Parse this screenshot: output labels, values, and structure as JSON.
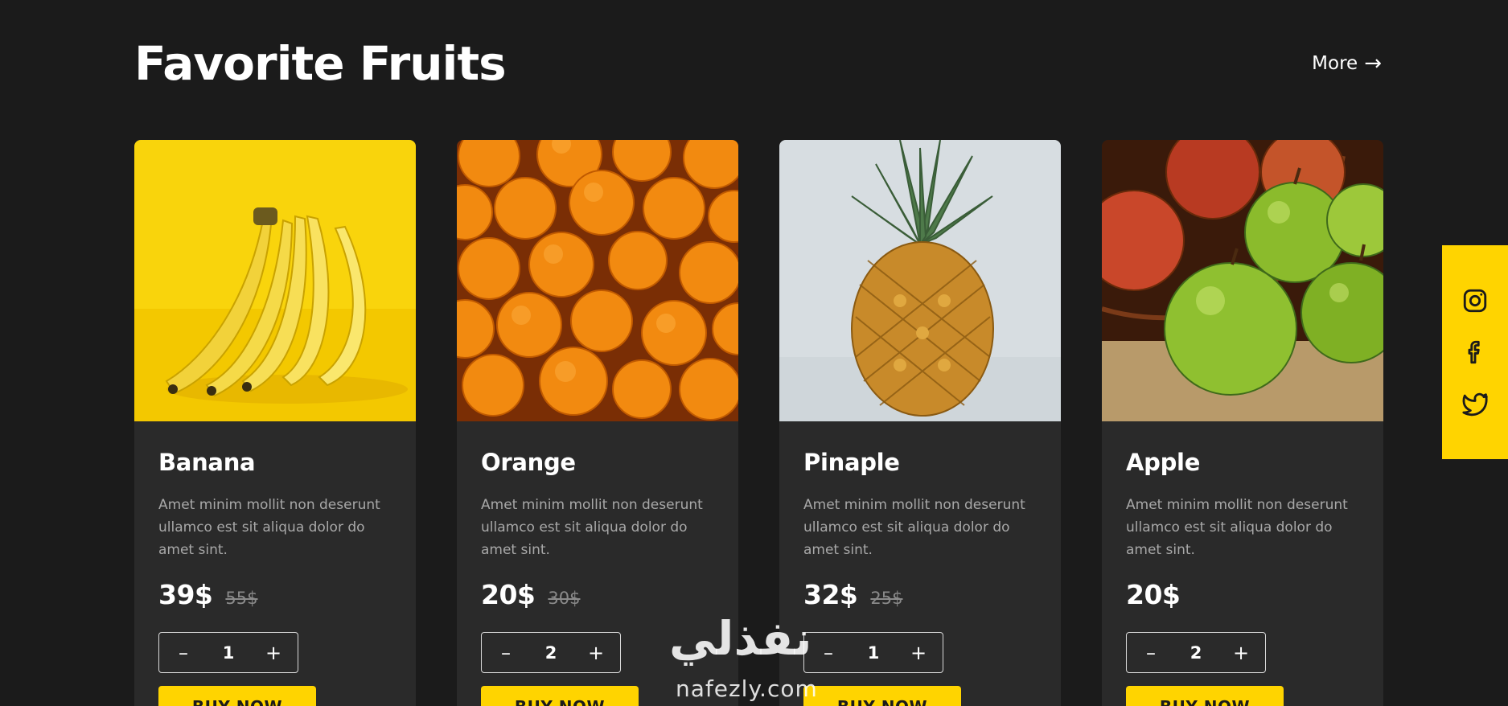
{
  "header": {
    "title": "Favorite Fruits",
    "more_label": "More",
    "more_arrow": "→"
  },
  "products": [
    {
      "name": "Banana",
      "image": "banana-image",
      "description": "Amet minim mollit non deserunt ullamco est sit aliqua dolor do amet sint.",
      "price": "39$",
      "old_price": "55$",
      "quantity": "1",
      "minus": "–",
      "plus": "+",
      "buy_label": "BUY NOW"
    },
    {
      "name": "Orange",
      "image": "orange-image",
      "description": "Amet minim mollit non deserunt ullamco est sit aliqua dolor do amet sint.",
      "price": "20$",
      "old_price": "30$",
      "quantity": "2",
      "minus": "–",
      "plus": "+",
      "buy_label": "BUY NOW"
    },
    {
      "name": "Pinaple",
      "image": "pineapple-image",
      "description": "Amet minim mollit non deserunt ullamco est sit aliqua dolor do amet sint.",
      "price": "32$",
      "old_price": "25$",
      "quantity": "1",
      "minus": "–",
      "plus": "+",
      "buy_label": "BUY NOW"
    },
    {
      "name": "Apple",
      "image": "apple-image",
      "description": "Amet minim mollit non deserunt ullamco est sit aliqua dolor do amet sint.",
      "price": "20$",
      "old_price": "",
      "quantity": "2",
      "minus": "–",
      "plus": "+",
      "buy_label": "BUY NOW"
    }
  ],
  "social": {
    "icons": [
      "instagram-icon",
      "facebook-icon",
      "twitter-icon"
    ]
  },
  "watermark": {
    "arabic": "نفذلي",
    "latin": "nafezly.com"
  },
  "colors": {
    "background": "#1b1b1b",
    "card": "#2a2a2a",
    "accent": "#ffd400"
  }
}
